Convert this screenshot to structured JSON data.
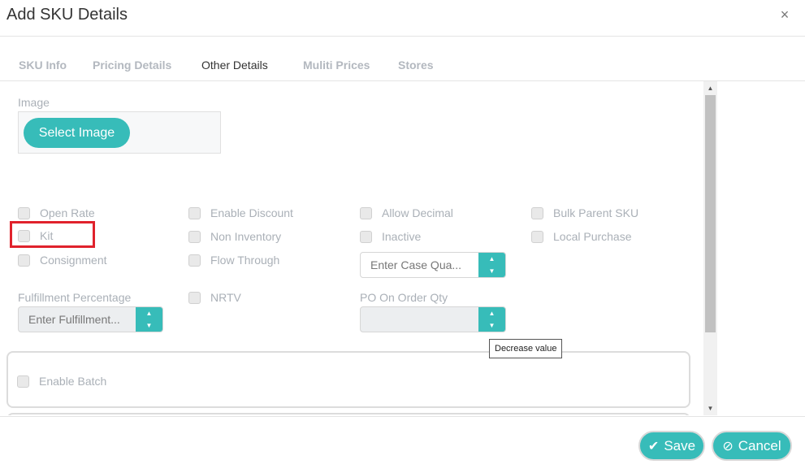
{
  "header": {
    "title": "Add SKU Details",
    "close_glyph": "×"
  },
  "tabs": [
    {
      "label": "SKU Info"
    },
    {
      "label": "Pricing Details"
    },
    {
      "label": "Other Details"
    },
    {
      "label": "Muliti Prices"
    },
    {
      "label": "Stores"
    }
  ],
  "image_section": {
    "label": "Image",
    "button_label": "Select Image"
  },
  "checkboxes": {
    "open_rate": "Open Rate",
    "enable_discount": "Enable Discount",
    "allow_decimal": "Allow Decimal",
    "bulk_parent_sku": "Bulk Parent SKU",
    "kit": "Kit",
    "non_inventory": "Non Inventory",
    "inactive": "Inactive",
    "local_purchase": "Local Purchase",
    "consignment": "Consignment",
    "flow_through": "Flow Through",
    "nrtv": "NRTV",
    "enable_batch": "Enable Batch"
  },
  "case_quantity": {
    "placeholder": "Enter Case Qua..."
  },
  "fulfillment": {
    "label": "Fulfillment Percentage",
    "placeholder": "Enter Fulfillment..."
  },
  "po_on_order": {
    "label": "PO On Order Qty",
    "value": ""
  },
  "tooltip": {
    "text": "Decrease value"
  },
  "footer": {
    "save_label": "Save",
    "cancel_label": "Cancel"
  },
  "colors": {
    "accent": "#37bcb9",
    "highlight": "#e0222c"
  }
}
